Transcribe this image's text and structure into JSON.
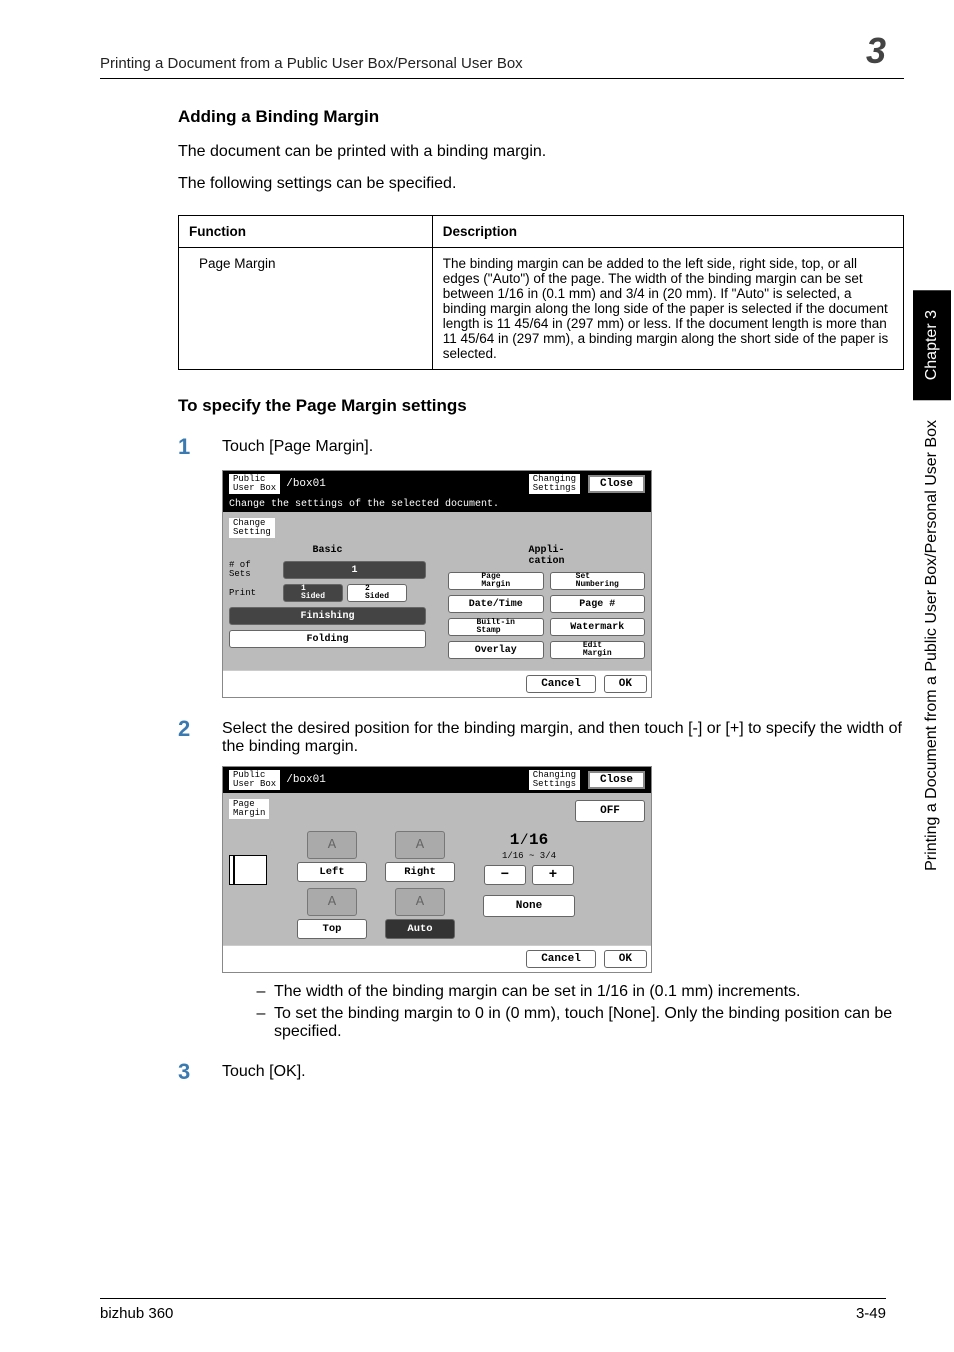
{
  "header": {
    "breadcrumb": "Printing a Document from a Public User Box/Personal User Box",
    "chapter_num": "3"
  },
  "section": {
    "heading1": "Adding a Binding Margin",
    "para1": "The document can be printed with a binding margin.",
    "para2": "The following settings can be specified."
  },
  "func_table": {
    "head_function": "Function",
    "head_description": "Description",
    "row1_function": "Page Margin",
    "row1_description": "The binding margin can be added to the left side, right side, top, or all edges (\"Auto\") of the page. The width of the binding margin can be set between 1/16 in (0.1 mm) and 3/4 in (20 mm). If \"Auto\" is selected, a binding margin along the long side of the paper is selected if the document length is 11 45/64 in (297 mm) or less. If the document length is more than 11 45/64 in (297 mm), a binding margin along the short side of the paper is selected."
  },
  "procedure_heading": "To specify the Page Margin settings",
  "steps": {
    "s1_num": "1",
    "s1_text": "Touch [Page Margin].",
    "s2_num": "2",
    "s2_text": "Select the desired position for the binding margin, and then touch [-] or [+] to specify the width of the binding margin.",
    "s3_num": "3",
    "s3_text": "Touch [OK]."
  },
  "panel1": {
    "title_line1": "Public",
    "title_line2": "User Box",
    "box": "/box01",
    "changing1": "Changing",
    "changing2": "Settings",
    "close": "Close",
    "subheader": "Change the settings of the selected document.",
    "tab": "Change\nSetting",
    "col_basic": "Basic",
    "col_appli": "Appli-\ncation",
    "sets_label": "# of\nSets",
    "sets_value": "1",
    "page_margin": "Page\nMargin",
    "set_numbering": "Set\nNumbering",
    "print_label": "Print",
    "sided1": "1\nSided",
    "sided2": "2\nSided",
    "date_time": "Date/Time",
    "page_num": "Page #",
    "finishing": "Finishing",
    "builtin": "Built-in\nStamp",
    "watermark": "Watermark",
    "folding": "Folding",
    "overlay": "Overlay",
    "edit_margin": "Edit\nMargin",
    "cancel": "Cancel",
    "ok": "OK"
  },
  "panel2": {
    "title_line1": "Public",
    "title_line2": "User Box",
    "box": "/box01",
    "changing1": "Changing",
    "changing2": "Settings",
    "close": "Close",
    "tab": "Page\nMargin",
    "off": "OFF",
    "left": "Left",
    "right": "Right",
    "top": "Top",
    "auto": "Auto",
    "fraction": "1⁄16",
    "range": "1/16  ~   3/4",
    "minus": "−",
    "plus": "+",
    "none": "None",
    "cancel": "Cancel",
    "ok": "OK"
  },
  "bullets": {
    "b1": "The width of the binding margin can be set in 1/16 in (0.1 mm) increments.",
    "b2": "To set the binding margin to 0 in (0 mm), touch [None]. Only the binding position can be specified."
  },
  "side": {
    "chapter": "Chapter 3",
    "title": "Printing a Document from a Public User Box/Personal User Box"
  },
  "footer": {
    "left": "bizhub 360",
    "right": "3-49"
  }
}
